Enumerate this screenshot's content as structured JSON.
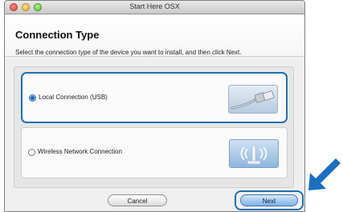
{
  "window": {
    "title": "Start Here OSX"
  },
  "header": {
    "title": "Connection Type",
    "subtitle": "Select the connection type of the device you want to install, and then click Next."
  },
  "options": [
    {
      "label": "Local Connection (USB)",
      "selected": true,
      "icon": "usb-cable-icon"
    },
    {
      "label": "Wireless Network Connection",
      "selected": false,
      "icon": "wireless-icon"
    }
  ],
  "buttons": {
    "cancel": "Cancel",
    "next": "Next"
  },
  "colors": {
    "accent": "#1f6fb4",
    "arrow": "#1a6fc0"
  }
}
